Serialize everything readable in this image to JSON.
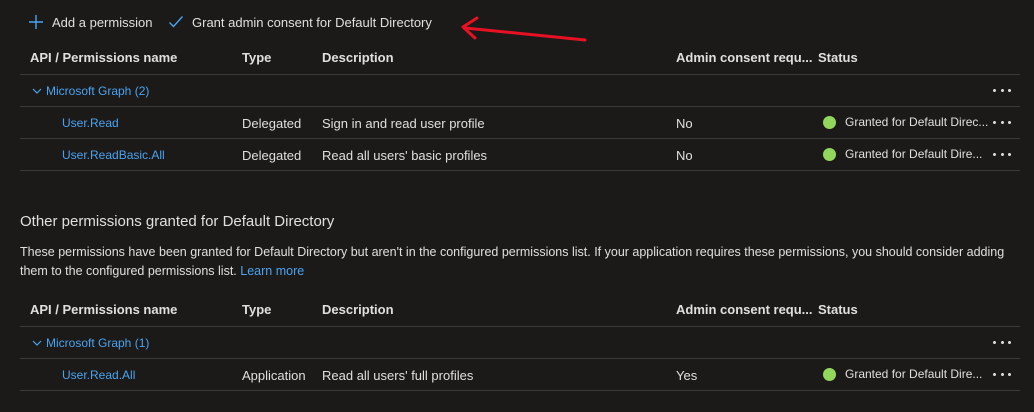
{
  "toolbar": {
    "add_permission": "Add a permission",
    "grant_consent": "Grant admin consent for Default Directory"
  },
  "columns": {
    "name": "API / Permissions name",
    "type": "Type",
    "description": "Description",
    "admin": "Admin consent requ...",
    "status": "Status"
  },
  "configured": {
    "group_label": "Microsoft Graph (2)",
    "rows": [
      {
        "name": "User.Read",
        "type": "Delegated",
        "description": "Sign in and read user profile",
        "admin": "No",
        "status": "Granted for Default Direc..."
      },
      {
        "name": "User.ReadBasic.All",
        "type": "Delegated",
        "description": "Read all users' basic profiles",
        "admin": "No",
        "status": "Granted for Default Dire..."
      }
    ]
  },
  "other": {
    "title": "Other permissions granted for Default Directory",
    "description": "These permissions have been granted for Default Directory but aren't in the configured permissions list. If your application requires these permissions, you should consider adding them to the configured permissions list.",
    "learn_more": "Learn more",
    "group_label": "Microsoft Graph (1)",
    "rows": [
      {
        "name": "User.Read.All",
        "type": "Application",
        "description": "Read all users' full profiles",
        "admin": "Yes",
        "status": "Granted for Default Dire..."
      }
    ]
  },
  "colors": {
    "background": "#1b1a19",
    "link": "#4aa3f0",
    "granted": "#92d65b",
    "arrow": "#e81123"
  },
  "icons": {
    "add": "plus-icon",
    "consent": "checkmark-icon",
    "status": "green-dot-icon",
    "more": "more-icon",
    "group": "chevron-down-icon"
  }
}
